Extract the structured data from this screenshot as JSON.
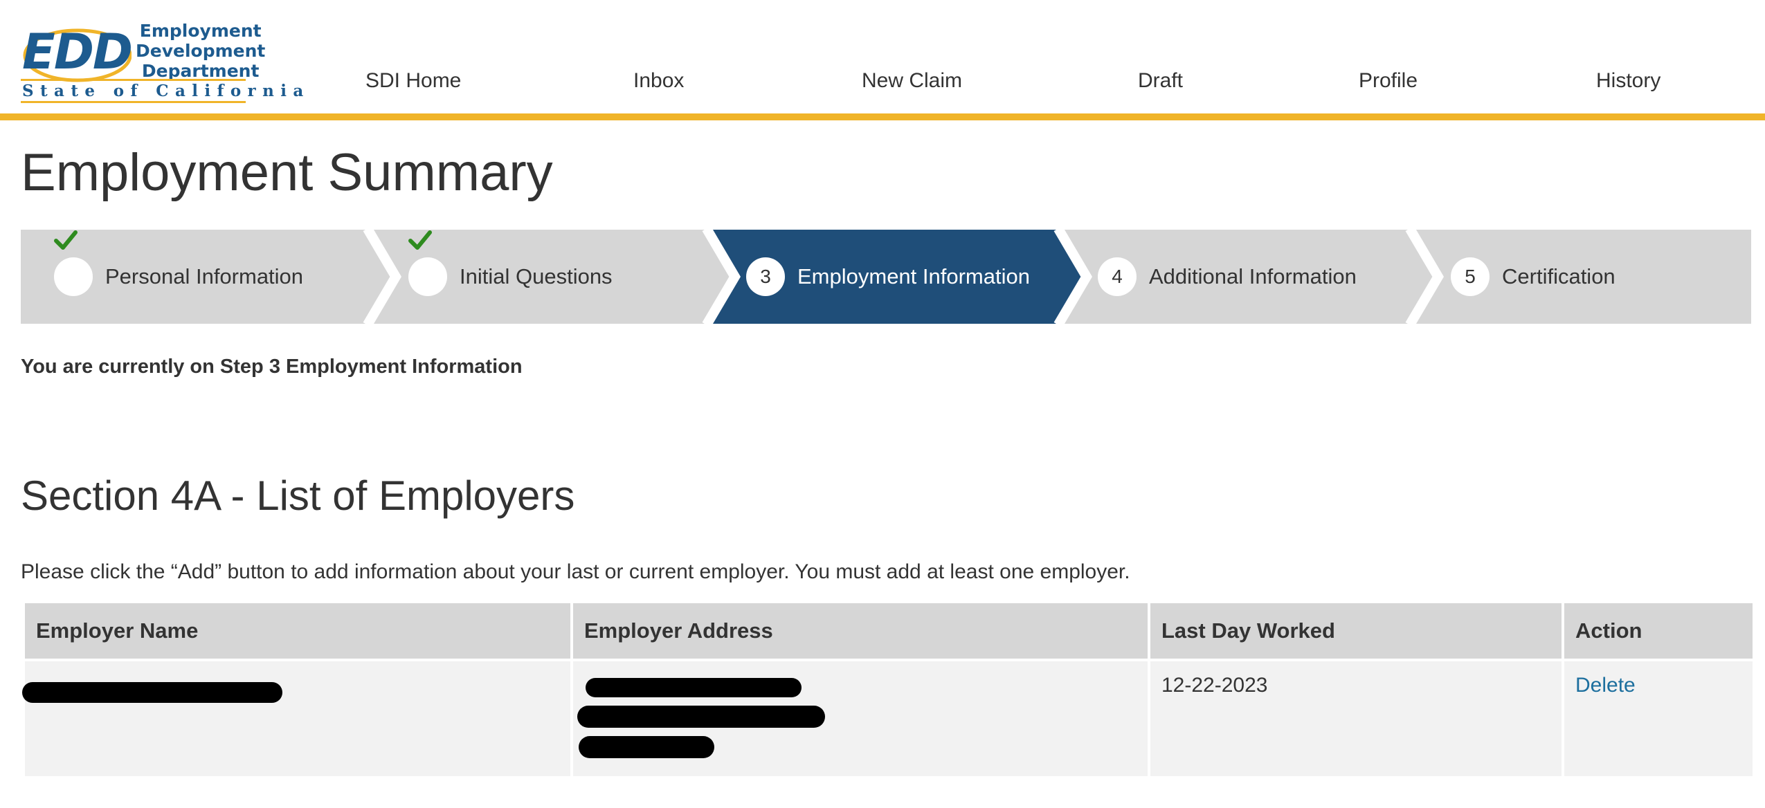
{
  "logo": {
    "abbr": "EDD",
    "dept_line1": "Employment",
    "dept_line2": "Development",
    "dept_line3": "Department",
    "state": "State of California"
  },
  "nav": [
    "SDI Home",
    "Inbox",
    "New Claim",
    "Draft",
    "Profile",
    "History"
  ],
  "page_title": "Employment Summary",
  "stepper": {
    "steps": [
      {
        "marker": "check",
        "label": "Personal Information",
        "state": "complete"
      },
      {
        "marker": "check",
        "label": "Initial Questions",
        "state": "complete"
      },
      {
        "marker": "3",
        "label": "Employment Information",
        "state": "active"
      },
      {
        "marker": "4",
        "label": "Additional Information",
        "state": "upcoming"
      },
      {
        "marker": "5",
        "label": "Certification",
        "state": "upcoming"
      }
    ],
    "colors": {
      "active": "#1f4e79",
      "inactive": "#d6d6d6",
      "check": "#2e8b1f"
    }
  },
  "current_step_text": "You are currently on Step 3 Employment Information",
  "section_title": "Section 4A - List of Employers",
  "instructions": "Please click the “Add” button to add information about your last or current employer. You must add at least one employer.",
  "table": {
    "headers": [
      "Employer Name",
      "Employer Address",
      "Last Day Worked",
      "Action"
    ],
    "rows": [
      {
        "employer_name": "[redacted]",
        "employer_address": "[redacted]",
        "last_day_worked": "12-22-2023",
        "action": "Delete"
      }
    ]
  },
  "colors": {
    "accent_bar": "#f0b429",
    "brand_blue": "#1d5b8f",
    "link": "#1d6f9e"
  }
}
